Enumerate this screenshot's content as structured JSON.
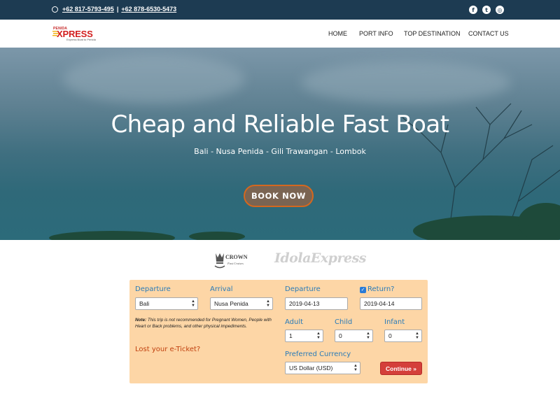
{
  "topbar": {
    "phone1": "+62 817-5793-495",
    "separator": "|",
    "phone2": "+62 878-6530-5473",
    "social": [
      "facebook-icon",
      "twitter-icon",
      "instagram-icon"
    ]
  },
  "logo": {
    "small": "PENIDA",
    "big": "XPRESS",
    "tagline": "Express Boat to Penida"
  },
  "nav": {
    "items": [
      "HOME",
      "PORT INFO",
      "TOP DESTINATION",
      "CONTACT US"
    ]
  },
  "hero": {
    "title": "Cheap and Reliable Fast Boat",
    "subtitle": "Bali - Nusa Penida - Gili Trawangan - Lombok",
    "cta": "BOOK NOW"
  },
  "partners": {
    "crown_top": "CROWN",
    "crown_bottom": "Fast Cruises",
    "idola": "IdolaExpress"
  },
  "form": {
    "departure_label": "Departure",
    "departure_value": "Bali",
    "arrival_label": "Arrival",
    "arrival_value": "Nusa Penida",
    "departure_date_label": "Departure",
    "departure_date": "2019-04-13",
    "return_label": "Return?",
    "return_checked": true,
    "return_date": "2019-04-14",
    "note_prefix": "Note:",
    "note_text": "This trip is not recommended for Pregnant Women, People with Heart or Back problems, and other physical impediments.",
    "lost_ticket": "Lost your e-Ticket?",
    "adult_label": "Adult",
    "adult_value": "1",
    "child_label": "Child",
    "child_value": "0",
    "infant_label": "Infant",
    "infant_value": "0",
    "currency_label": "Preferred Currency",
    "currency_value": "US Dollar (USD)",
    "continue_label": "Continue »"
  },
  "colors": {
    "topbar": "#1d3b52",
    "form_bg": "#fdd6a6",
    "label_blue": "#2a7bb8",
    "continue_red": "#d43f3a",
    "book_border": "#d4681f"
  }
}
